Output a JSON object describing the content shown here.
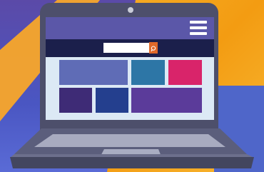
{
  "illustration": {
    "subject": "laptop",
    "colors": {
      "background_orange": "#f5a623",
      "background_purple": "#5b4aa8",
      "laptop_body": "#4d4f6b",
      "nav_bar": "#5b57a8",
      "search_strip": "#1b1f4b",
      "search_button": "#e0692a",
      "screen_bg": "#dce9f5"
    }
  },
  "screen": {
    "menu_icon": "hamburger-icon",
    "search": {
      "value": "",
      "placeholder": "",
      "button_icon": "search-icon"
    },
    "tiles": [
      {
        "color": "#5f6cb6"
      },
      {
        "color": "#2d76a6"
      },
      {
        "color": "#d9246a"
      },
      {
        "color": "#3e2b76"
      },
      {
        "color": "#243f8e"
      },
      {
        "color": "#5b3b9a"
      }
    ]
  }
}
